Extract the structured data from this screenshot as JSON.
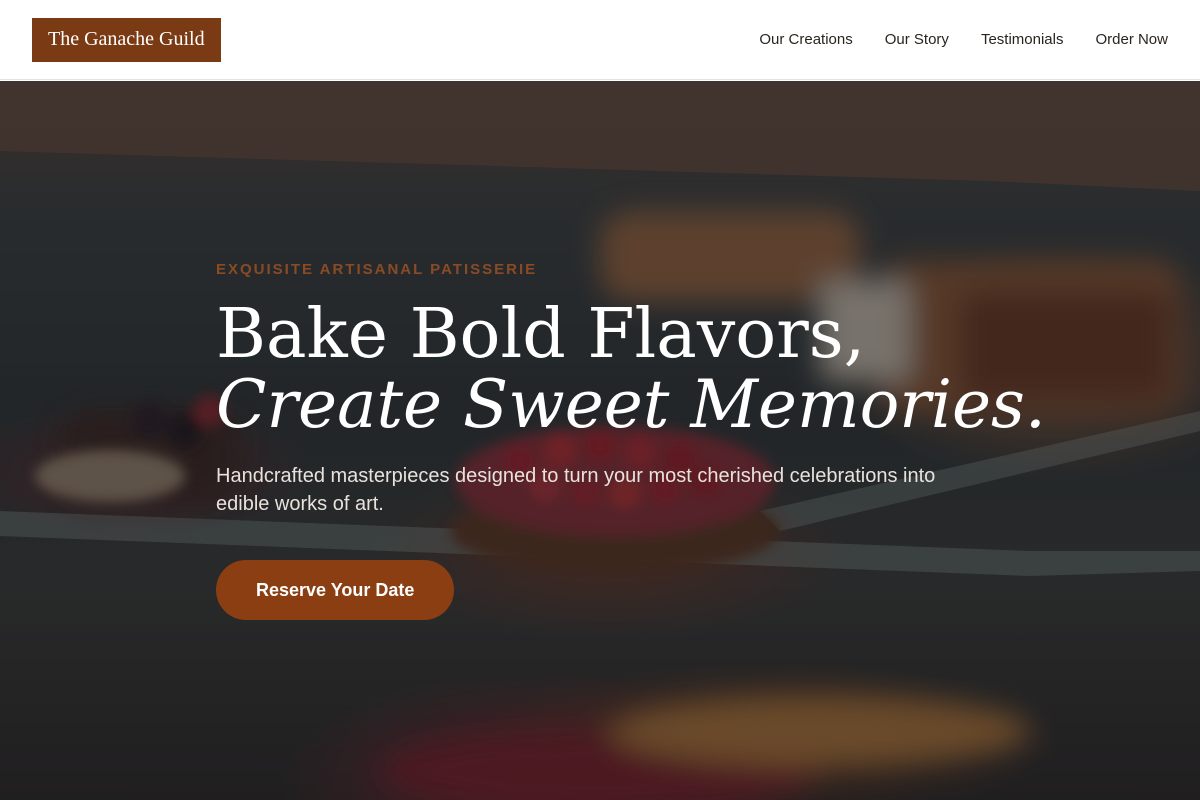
{
  "brand": {
    "name": "The Ganache Guild",
    "color": "#7a3a14"
  },
  "nav": {
    "items": [
      {
        "label": "Our Creations"
      },
      {
        "label": "Our Story"
      },
      {
        "label": "Testimonials"
      },
      {
        "label": "Order Now"
      }
    ]
  },
  "hero": {
    "eyebrow": "EXQUISITE ARTISANAL PATISSERIE",
    "headline_line1": "Bake Bold Flavors,",
    "headline_line2": "Create Sweet Memories.",
    "subtext": "Handcrafted masterpieces designed to turn your most cherished celebrations into edible works of art.",
    "cta_label": "Reserve Your Date",
    "cta_color": "#8a3e12",
    "eyebrow_color": "#8a4b24",
    "background_image": "blurred-patisserie-display-case-with-berry-tarts"
  }
}
